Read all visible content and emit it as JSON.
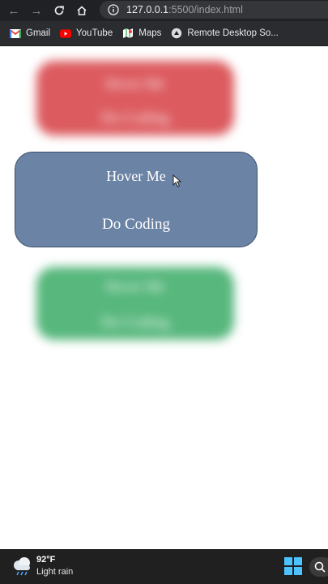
{
  "browser": {
    "url_host": "127.0.0.1",
    "url_rest": ":5500/index.html"
  },
  "bookmarks": [
    {
      "label": "Gmail",
      "icon": "gmail-icon"
    },
    {
      "label": "YouTube",
      "icon": "youtube-icon"
    },
    {
      "label": "Maps",
      "icon": "maps-icon"
    },
    {
      "label": "Remote Desktop So...",
      "icon": "remote-desktop-icon"
    }
  ],
  "cards": [
    {
      "color": "#dc5b5f",
      "line1": "Hover Me",
      "line2": "Do Coding",
      "state": "blurred"
    },
    {
      "color": "#6b84a6",
      "line1": "Hover Me",
      "line2": "Do Coding",
      "state": "hovered"
    },
    {
      "color": "#57b77c",
      "line1": "Hover Me",
      "line2": "Do Coding",
      "state": "blurred"
    }
  ],
  "taskbar": {
    "temperature": "92°F",
    "condition": "Light rain"
  },
  "colors": {
    "chrome_dark": "#202124",
    "bookmarks_bar": "#2b2c30",
    "windows_accent": "#4cc2ff"
  }
}
